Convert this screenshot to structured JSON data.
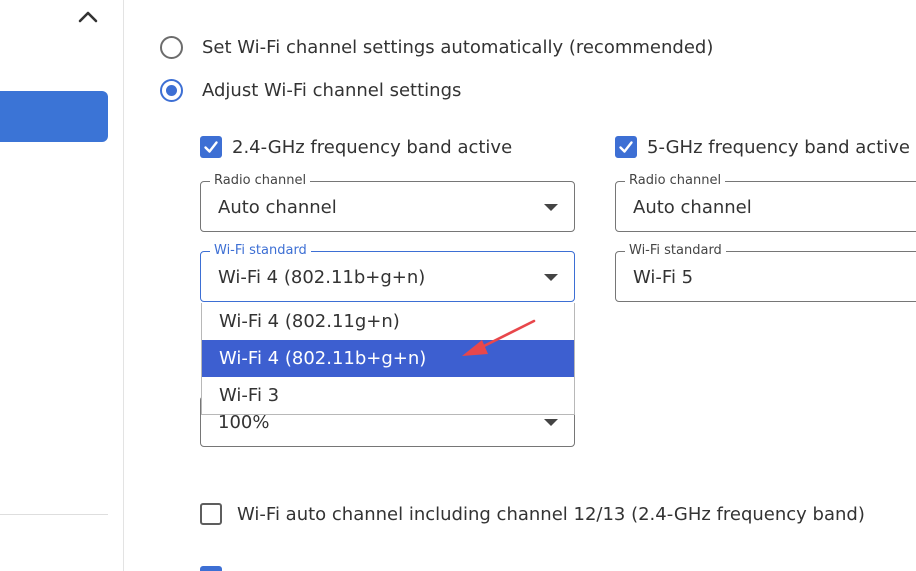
{
  "sidebar": {
    "collapse_icon": "chevron-up-icon"
  },
  "channel_mode": {
    "auto_label": "Set Wi-Fi channel settings automatically (recommended)",
    "manual_label": "Adjust Wi-Fi channel settings",
    "selected": "manual"
  },
  "band_24": {
    "active_label": "2.4-GHz frequency band active",
    "active": true,
    "radio_channel": {
      "legend": "Radio channel",
      "value": "Auto channel"
    },
    "wifi_standard": {
      "legend": "Wi-Fi standard",
      "value": "Wi-Fi 4 (802.11b+g+n)"
    },
    "power": {
      "value": "100%"
    }
  },
  "band_5": {
    "active_label": "5-GHz frequency band active",
    "active": true,
    "radio_channel": {
      "legend": "Radio channel",
      "value": "Auto channel"
    },
    "wifi_standard": {
      "legend": "Wi-Fi standard",
      "value": "Wi-Fi 5"
    }
  },
  "dropdown": {
    "options": [
      {
        "label": "Wi-Fi 4 (802.11g+n)"
      },
      {
        "label": "Wi-Fi 4 (802.11b+g+n)",
        "selected": true
      },
      {
        "label": "Wi-Fi 3"
      }
    ]
  },
  "auto_channel_1213": {
    "label": "Wi-Fi auto channel including channel 12/13 (2.4-GHz frequency band)",
    "checked": false
  },
  "colors": {
    "accent": "#3d6fd4",
    "nav_active": "#3b74d6",
    "dropdown_selected": "#3d5fd0",
    "annotation_arrow": "#e8474b"
  }
}
